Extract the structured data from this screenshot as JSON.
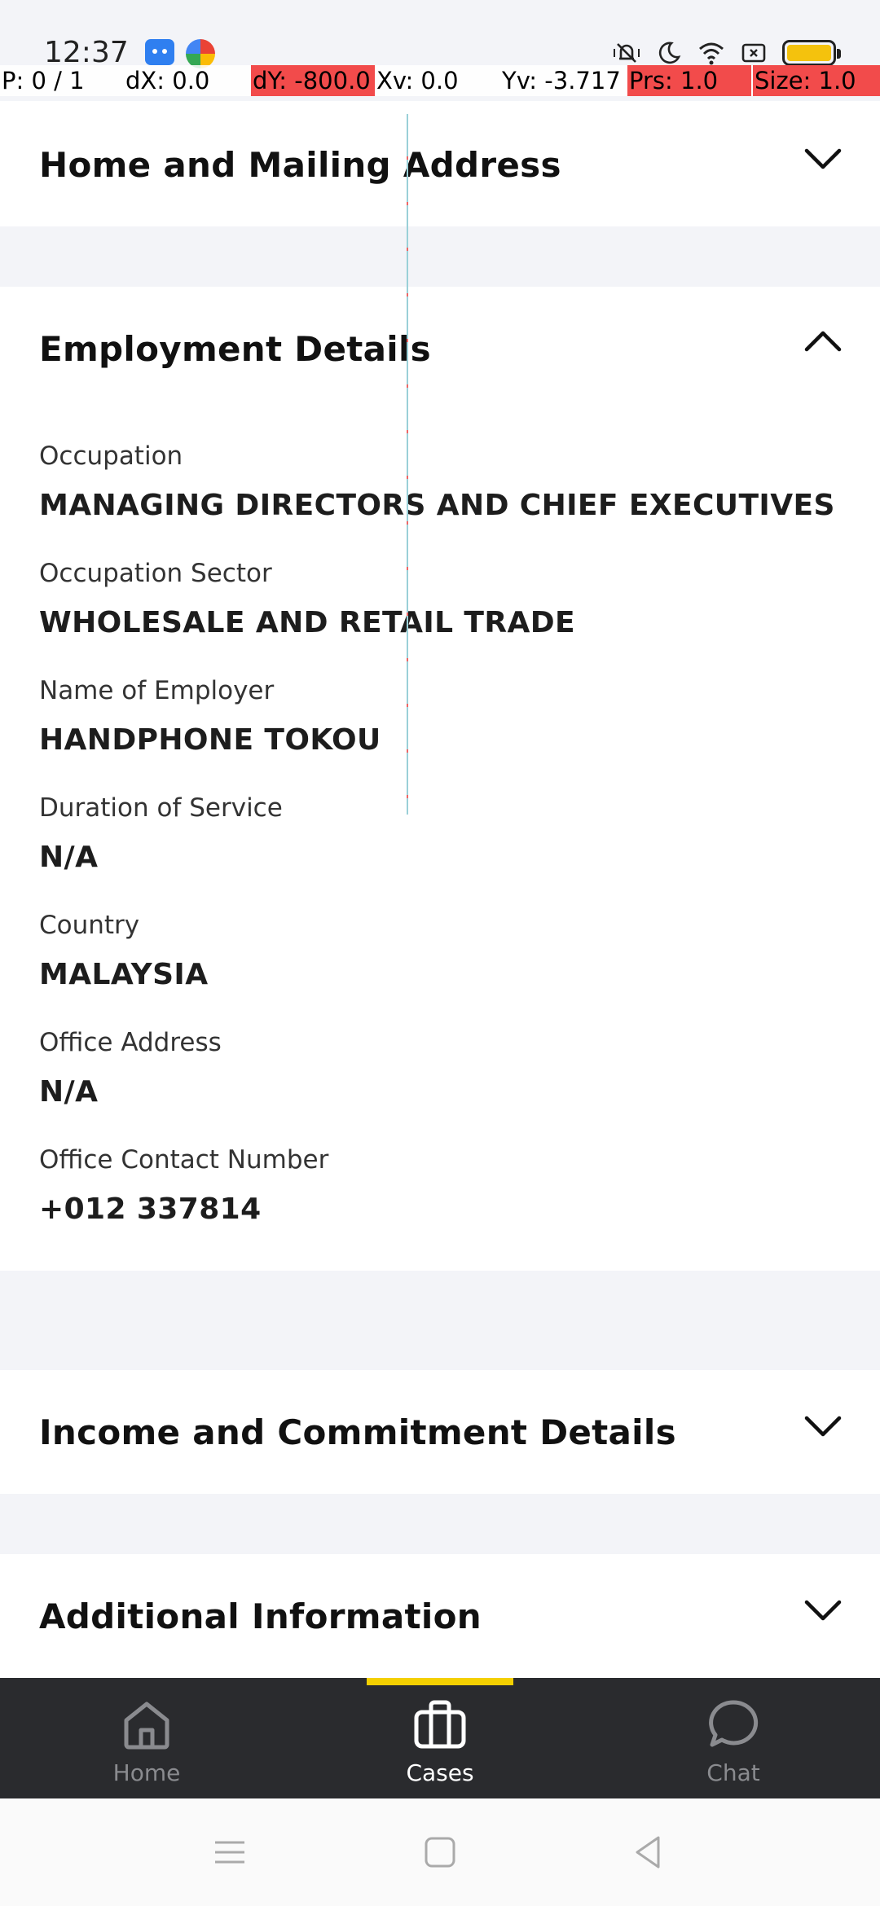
{
  "status_bar": {
    "time": "12:37",
    "icons": [
      "android-app-icon",
      "browser-app-icon",
      "muted-vibrate-icon",
      "moon-icon",
      "wifi-icon",
      "sim-icon",
      "battery-icon"
    ],
    "battery_color": "#f4c20d"
  },
  "pointer_overlay": {
    "p": "P: 0 / 1",
    "dx": "dX: 0.0",
    "dy": "dY: -800.0",
    "xv": "Xv: 0.0",
    "yv": "Yv: -3.717",
    "prs": "Prs: 1.0",
    "size": "Size: 1.0"
  },
  "sections": {
    "home_mailing": {
      "title": "Home and Mailing Address",
      "expanded": false
    },
    "employment": {
      "title": "Employment Details",
      "expanded": true,
      "fields": [
        {
          "label": "Occupation",
          "value": "MANAGING DIRECTORS AND CHIEF EXECUTIVES"
        },
        {
          "label": "Occupation Sector",
          "value": "WHOLESALE AND RETAIL TRADE"
        },
        {
          "label": "Name of Employer",
          "value": "HANDPHONE TOKOU"
        },
        {
          "label": "Duration of Service",
          "value": "N/A"
        },
        {
          "label": "Country",
          "value": "MALAYSIA"
        },
        {
          "label": "Office Address",
          "value": "N/A"
        },
        {
          "label": "Office Contact Number",
          "value": "+012 337814"
        }
      ]
    },
    "income": {
      "title": "Income and Commitment Details",
      "expanded": false
    },
    "additional": {
      "title": "Additional Information",
      "expanded": false
    }
  },
  "bottom_nav": {
    "items": [
      {
        "label": "Home",
        "icon": "home-icon",
        "active": false
      },
      {
        "label": "Cases",
        "icon": "briefcase-icon",
        "active": true
      },
      {
        "label": "Chat",
        "icon": "chat-bubble-icon",
        "active": false
      }
    ],
    "active_color": "#f4d000"
  },
  "system_nav": {
    "icons": [
      "menu-icon",
      "home-square-icon",
      "back-triangle-icon"
    ]
  }
}
